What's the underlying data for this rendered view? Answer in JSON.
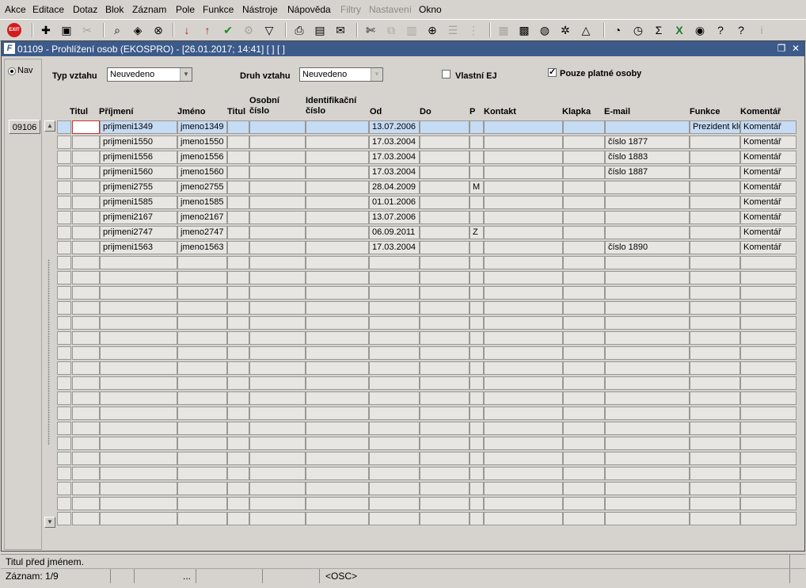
{
  "menu": [
    "Akce",
    "Editace",
    "Dotaz",
    "Blok",
    "Záznam",
    "Pole",
    "Funkce",
    "Nástroje",
    "Nápověda",
    "Filtry",
    "Nastavení",
    "Okno"
  ],
  "menu_disabled": [
    "Filtry",
    "Nastavení"
  ],
  "toolbar": {
    "exit_label": "EXIT",
    "icons": [
      "exit-icon",
      "new-record-icon",
      "save-icon",
      "clear-icon",
      "find-icon",
      "query-icon",
      "cancel-query-icon",
      "sort-asc-icon",
      "sort-desc-icon",
      "accept-icon",
      "tools-icon",
      "filter-icon",
      "print-icon",
      "report-icon",
      "mail-icon",
      "cut-icon",
      "copy-icon",
      "paste-icon",
      "zoom-icon",
      "list-icon",
      "tree-icon",
      "calendar-icon",
      "calculator-icon",
      "globe-icon",
      "settings-icon",
      "shape-icon",
      "chart-icon",
      "clock-icon",
      "sum-icon",
      "excel-icon",
      "web-icon",
      "help-search-icon",
      "help-icon",
      "info-icon"
    ],
    "sum_glyph": "Σ",
    "help_glyph": "?",
    "info_glyph": "i"
  },
  "window": {
    "title": "01109 - Prohlížení osob (EKOSPRO) - [26.01.2017; 14:41] [ ] [ ]"
  },
  "nav": {
    "label": "Nav",
    "code": "09106"
  },
  "filters": {
    "typ_label": "Typ vztahu",
    "typ_value": "Neuvedeno",
    "druh_label": "Druh vztahu",
    "druh_value": "Neuvedeno",
    "vlastni_label": "Vlastní EJ",
    "vlastni_checked": false,
    "platne_label": "Pouze platné osoby",
    "platne_checked": true
  },
  "columns": [
    "Titul",
    "Příjmení",
    "Jméno",
    "Titul",
    "Osobní číslo",
    "Identifikační číslo",
    "Od",
    "Do",
    "P",
    "Kontakt",
    "Klapka",
    "E-mail",
    "Funkce",
    "Komentář"
  ],
  "rows": [
    [
      "",
      "prijmeni1349",
      "jmeno1349",
      "",
      "",
      "",
      "13.07.2006",
      "",
      "",
      "",
      "",
      "",
      "Prezident klubu",
      "Komentář"
    ],
    [
      "",
      "prijmeni1550",
      "jmeno1550",
      "",
      "",
      "",
      "17.03.2004",
      "",
      "",
      "",
      "",
      "číslo 1877",
      "",
      "Komentář"
    ],
    [
      "",
      "prijmeni1556",
      "jmeno1556",
      "",
      "",
      "",
      "17.03.2004",
      "",
      "",
      "",
      "",
      "číslo 1883",
      "",
      "Komentář"
    ],
    [
      "",
      "prijmeni1560",
      "jmeno1560",
      "",
      "",
      "",
      "17.03.2004",
      "",
      "",
      "",
      "",
      "číslo 1887",
      "",
      "Komentář"
    ],
    [
      "",
      "prijmeni2755",
      "jmeno2755",
      "",
      "",
      "",
      "28.04.2009",
      "",
      "M",
      "",
      "",
      "",
      "",
      "Komentář"
    ],
    [
      "",
      "prijmeni1585",
      "jmeno1585",
      "",
      "",
      "",
      "01.01.2006",
      "",
      "",
      "",
      "",
      "",
      "",
      "Komentář"
    ],
    [
      "",
      "prijmeni2167",
      "jmeno2167",
      "",
      "",
      "",
      "13.07.2006",
      "",
      "",
      "",
      "",
      "",
      "",
      "Komentář"
    ],
    [
      "",
      "prijmeni2747",
      "jmeno2747",
      "",
      "",
      "",
      "06.09.2011",
      "",
      "Z",
      "",
      "",
      "",
      "",
      "Komentář"
    ],
    [
      "",
      "prijmeni1563",
      "jmeno1563",
      "",
      "",
      "",
      "17.03.2004",
      "",
      "",
      "",
      "",
      "číslo 1890",
      "",
      "Komentář"
    ]
  ],
  "total_rows": 27,
  "status": {
    "hint": "Titul před jménem.",
    "record": "Záznam: 1/9",
    "ellipsis": "...",
    "mode": "<OSC>"
  }
}
